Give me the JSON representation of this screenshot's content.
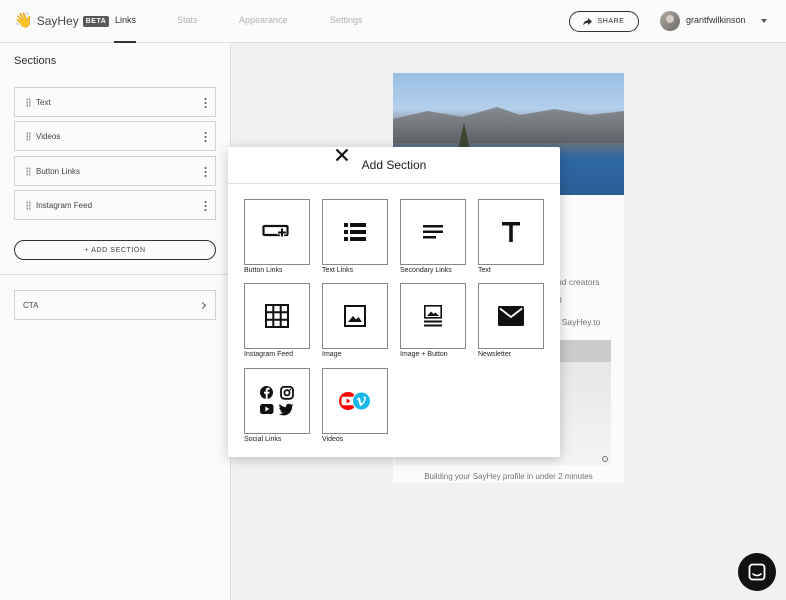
{
  "header": {
    "app_name": "SayHey",
    "beta_badge": "BETA",
    "hand_glyph": "👋",
    "tabs": [
      {
        "label": "Links",
        "active": true
      },
      {
        "label": "Stats",
        "active": false
      },
      {
        "label": "Appearance",
        "active": false
      },
      {
        "label": "Settings",
        "active": false
      }
    ],
    "share_label": "SHARE",
    "username": "grantfwilkinson"
  },
  "sidebar": {
    "title": "Sections",
    "items": [
      {
        "label": "Text"
      },
      {
        "label": "Videos"
      },
      {
        "label": "Button Links"
      },
      {
        "label": "Instagram Feed"
      }
    ],
    "add_section_label": "+ ADD SECTION",
    "cta_label": "CTA"
  },
  "preview": {
    "line1": "nd creators",
    "line2": "0",
    "line3": "t SayHey.to",
    "caption": "Building your SayHey profile in under 2 minutes"
  },
  "modal": {
    "title": "Add Section",
    "options": [
      {
        "label": "Button Links",
        "icon": "button-link-icon"
      },
      {
        "label": "Text Links",
        "icon": "list-icon"
      },
      {
        "label": "Secondary Links",
        "icon": "lines-icon"
      },
      {
        "label": "Text",
        "icon": "text-t-icon"
      },
      {
        "label": "Instagram Feed",
        "icon": "grid-icon"
      },
      {
        "label": "Image",
        "icon": "image-icon"
      },
      {
        "label": "Image + Button",
        "icon": "image-button-icon"
      },
      {
        "label": "Newsletter",
        "icon": "envelope-icon"
      },
      {
        "label": "Social Links",
        "icon": "social-icons"
      },
      {
        "label": "Videos",
        "icon": "video-platform-icons"
      }
    ]
  },
  "colors": {
    "accent": "#222222",
    "youtube": "#ff0000",
    "vimeo": "#1ab7ea"
  }
}
